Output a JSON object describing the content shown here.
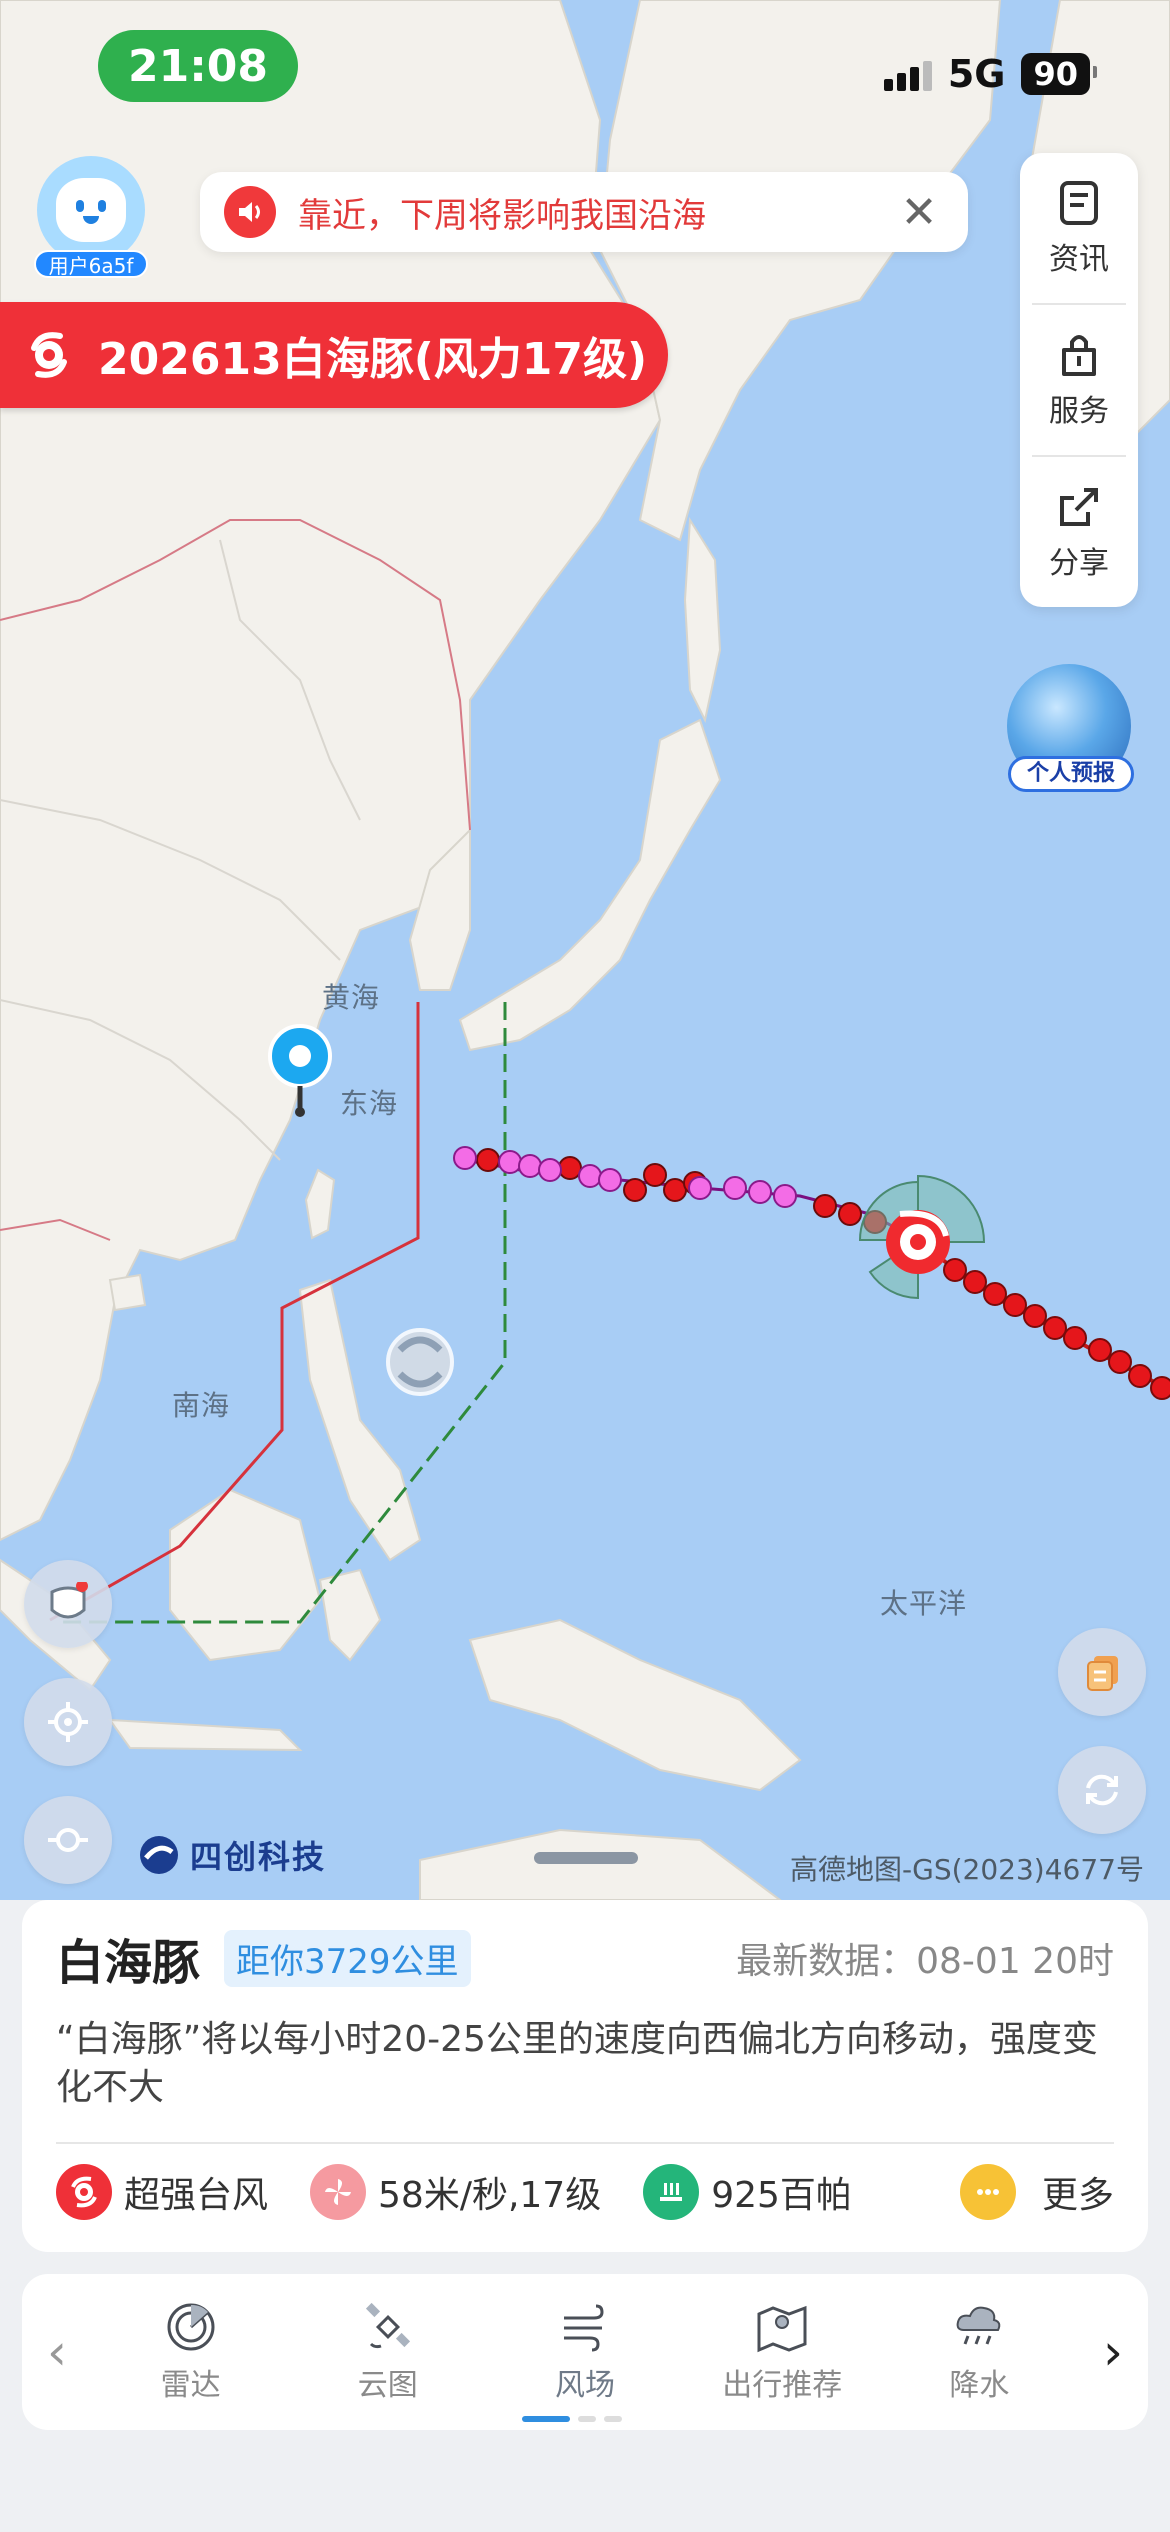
{
  "status": {
    "time": "21:08",
    "network": "5G",
    "battery": "90"
  },
  "user": {
    "tag": "用户6a5f"
  },
  "notice": {
    "text": "靠近，下周将影响我国沿海",
    "close": "✕"
  },
  "typhoon": {
    "title": "202613白海豚(风力17级)"
  },
  "side_menu": [
    {
      "label": "资讯",
      "icon": "news-icon"
    },
    {
      "label": "服务",
      "icon": "service-icon"
    },
    {
      "label": "分享",
      "icon": "share-icon"
    }
  ],
  "personal_forecast": {
    "label": "个人预报"
  },
  "map": {
    "labels": {
      "yellow_sea": "黄海",
      "east_sea": "东海",
      "south_sea": "南海",
      "pacific": "太平洋"
    },
    "brand": "四创科技",
    "copyright": "高德地图-GS(2023)4677号"
  },
  "info": {
    "name": "白海豚",
    "distance": "距你3729公里",
    "latest": "最新数据：08-01 20时",
    "description": "“白海豚”将以每小时20-25公里的速度向西偏北方向移动，强度变化不大",
    "stats": {
      "category": "超强台风",
      "wind": "58米/秒,17级",
      "pressure": "925百帕",
      "more": "更多"
    }
  },
  "tabs": [
    {
      "label": "雷达",
      "icon": "radar-icon"
    },
    {
      "label": "云图",
      "icon": "satellite-icon"
    },
    {
      "label": "风场",
      "icon": "wind-icon"
    },
    {
      "label": "出行推荐",
      "icon": "travel-map-icon"
    },
    {
      "label": "降水",
      "icon": "rain-icon"
    }
  ],
  "colors": {
    "accent": "#2f8ee0",
    "alert": "#ef3038",
    "sea": "#a8cdf5",
    "land": "#f3f1ec"
  }
}
